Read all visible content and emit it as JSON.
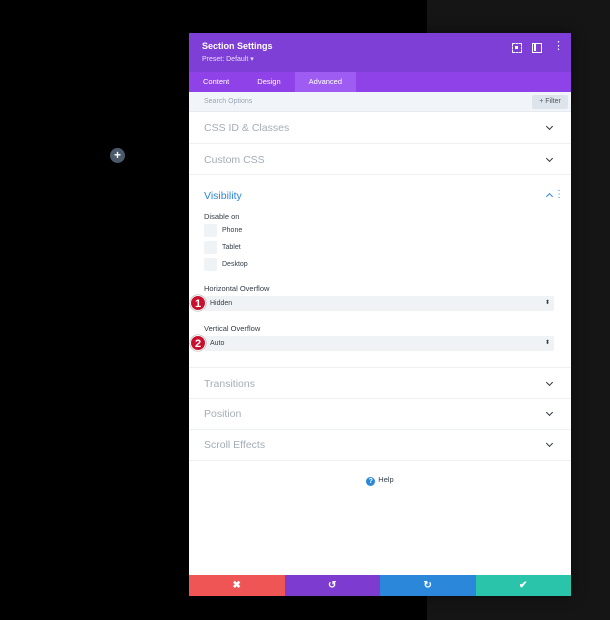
{
  "header": {
    "title": "Section Settings",
    "preset": "Preset: Default ▾",
    "icons": [
      "expand-icon",
      "layout-icon",
      "kebab-menu-icon"
    ]
  },
  "tabs": [
    {
      "label": "Content",
      "active": false
    },
    {
      "label": "Design",
      "active": false
    },
    {
      "label": "Advanced",
      "active": true
    }
  ],
  "search": {
    "placeholder": "Search Options",
    "filter_label": "+ Filter"
  },
  "sections": {
    "css_id": "CSS ID & Classes",
    "custom_css": "Custom CSS",
    "visibility": "Visibility",
    "transitions": "Transitions",
    "position": "Position",
    "scroll_effects": "Scroll Effects"
  },
  "visibility": {
    "disable_on_label": "Disable on",
    "devices": [
      "Phone",
      "Tablet",
      "Desktop"
    ],
    "h_overflow_label": "Horizontal Overflow",
    "h_overflow_value": "Hidden",
    "v_overflow_label": "Vertical Overflow",
    "v_overflow_value": "Auto"
  },
  "badges": [
    "1",
    "2"
  ],
  "help_label": "Help",
  "footer": {
    "cancel": "✖",
    "undo": "↺",
    "redo": "↻",
    "save": "✔"
  },
  "add_button": "+",
  "colors": {
    "header": "#7d3fd5",
    "tabs": "#8e42e7",
    "accent_blue": "#2b87da",
    "cancel": "#ef5555",
    "undo": "#7e3bd0",
    "redo": "#2b87da",
    "save": "#29c4a9",
    "badge": "#c8102e"
  }
}
